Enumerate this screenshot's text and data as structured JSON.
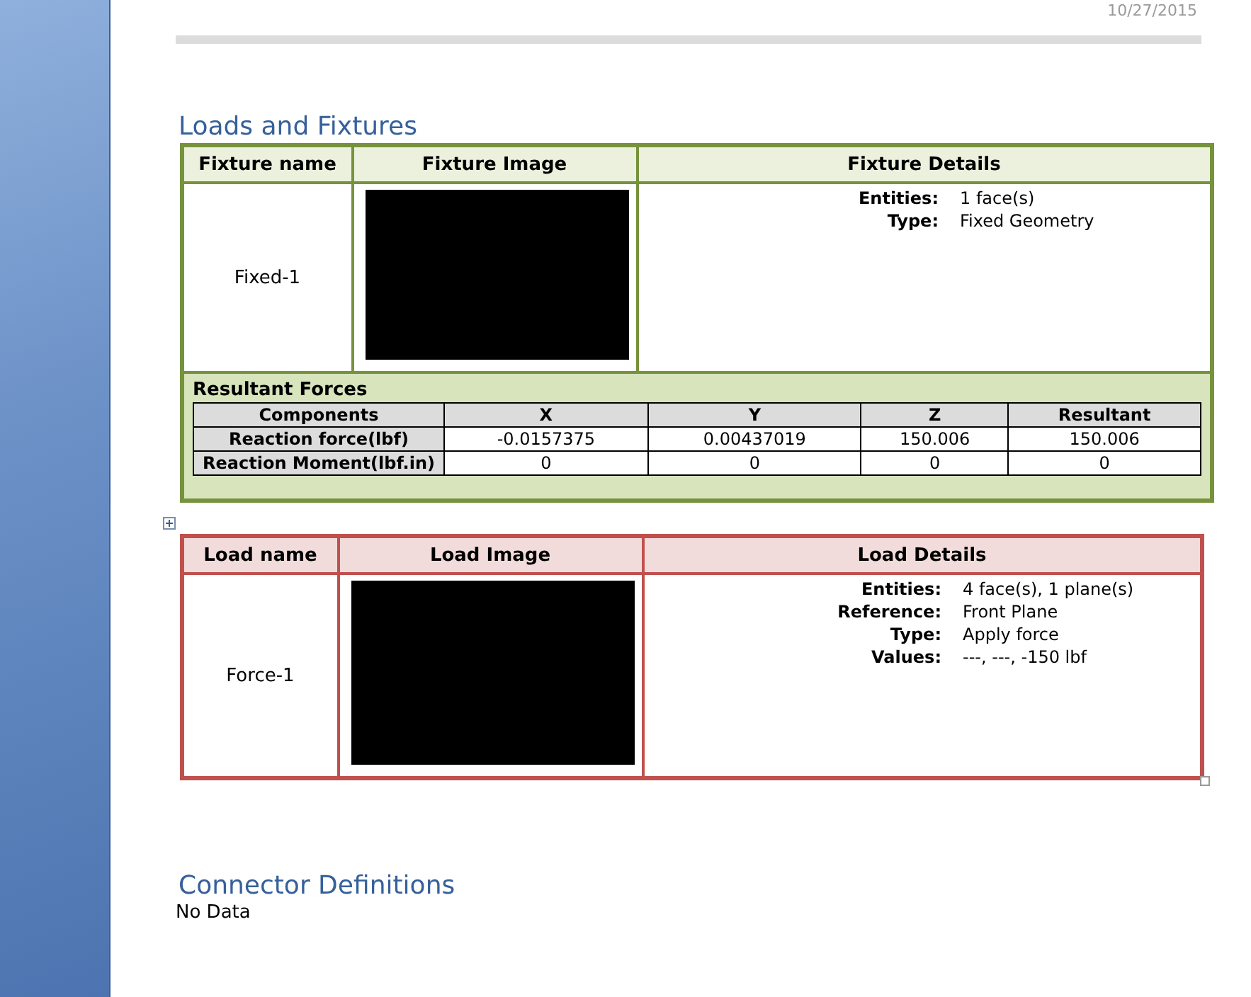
{
  "header_date": "10/27/2015",
  "loads_and_fixtures": {
    "title": "Loads and Fixtures",
    "fixture_table": {
      "columns": [
        "Fixture name",
        "Fixture Image",
        "Fixture Details"
      ],
      "rows": [
        {
          "name": "Fixed-1",
          "image": {
            "kind": "picture"
          },
          "details": [
            {
              "label": "Entities:",
              "value": "1 face(s)"
            },
            {
              "label": "Type:",
              "value": "Fixed Geometry"
            }
          ]
        }
      ],
      "resultant_forces": {
        "title": "Resultant Forces",
        "columns": [
          "Components",
          "X",
          "Y",
          "Z",
          "Resultant"
        ],
        "rows": [
          [
            "Reaction force(lbf)",
            "-0.0157375",
            "0.00437019",
            "150.006",
            "150.006"
          ],
          [
            "Reaction Moment(lbf.in)",
            "0",
            "0",
            "0",
            "0"
          ]
        ]
      }
    },
    "load_table": {
      "columns": [
        "Load name",
        "Load Image",
        "Load Details"
      ],
      "rows": [
        {
          "name": "Force-1",
          "image": {
            "kind": "picture"
          },
          "details": [
            {
              "label": "Entities:",
              "value": "4 face(s), 1 plane(s)"
            },
            {
              "label": "Reference:",
              "value": "Front Plane"
            },
            {
              "label": "Type:",
              "value": "Apply force"
            },
            {
              "label": "Values:",
              "value": "---, ---, -150 lbf"
            }
          ]
        }
      ]
    }
  },
  "connector_definitions": {
    "title": "Connector Definitions",
    "text": "No Data"
  }
}
